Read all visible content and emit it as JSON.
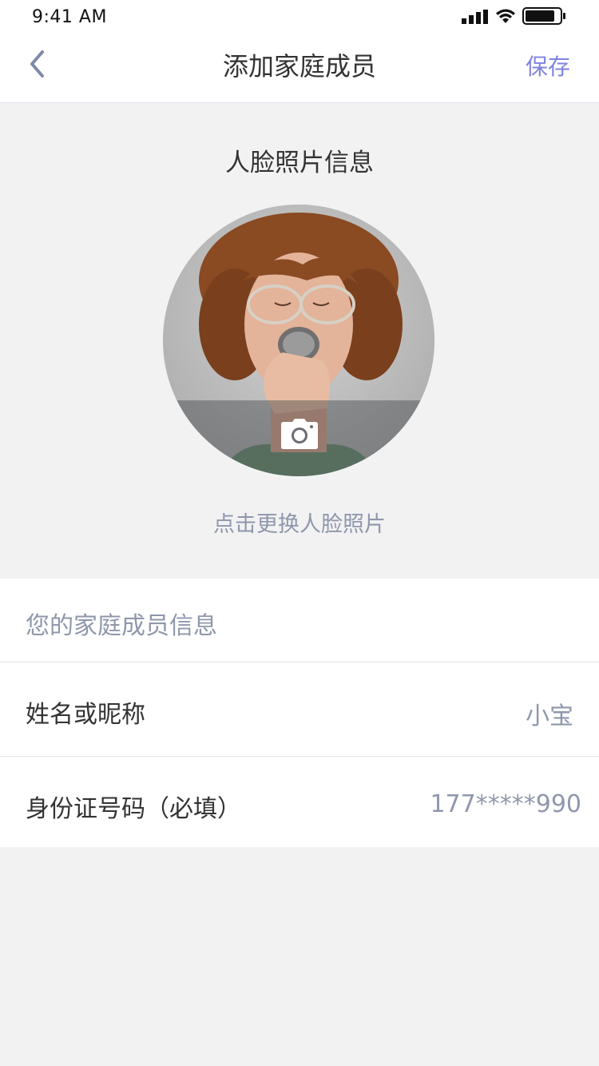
{
  "status_bar": {
    "time": "9:41 AM",
    "signal_icon": "cellular-signal-icon",
    "wifi_icon": "wifi-icon",
    "battery_icon": "battery-icon"
  },
  "nav": {
    "back_icon": "chevron-left-icon",
    "title": "添加家庭成员",
    "save_label": "保存"
  },
  "face_section": {
    "heading": "人脸照片信息",
    "camera_icon": "camera-icon",
    "change_link": "点击更换人脸照片"
  },
  "member_info": {
    "heading": "您的家庭成员信息",
    "rows": [
      {
        "label": "姓名或昵称",
        "value": "小宝"
      },
      {
        "label": "身份证号码（必填）",
        "value": "177*****990"
      }
    ]
  },
  "colors": {
    "accent": "#7f83e0",
    "muted_text": "#8f97ab",
    "primary_text": "#333333",
    "page_background": "#f2f2f3"
  }
}
